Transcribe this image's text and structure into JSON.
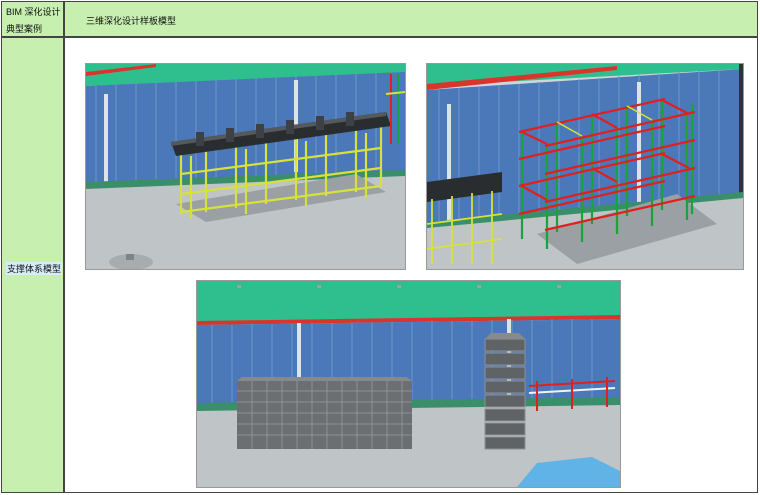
{
  "header": {
    "left_line1": "BIM 深化设计",
    "left_line2": "典型案例",
    "title": "三维深化设计样板模型"
  },
  "row": {
    "label": "支撑体系模型"
  },
  "images": [
    {
      "name": "support-frame-render-1"
    },
    {
      "name": "support-frame-render-2"
    },
    {
      "name": "formwork-stack-render"
    }
  ],
  "colors": {
    "cell_green": "#c6efb0",
    "label_highlight": "#d6ecf7",
    "scaffold_yellow": "#d6e23a",
    "scaffold_red": "#e02020",
    "scaffold_green": "#1aa33a",
    "wall_blue": "#4a78b8",
    "roof_teal": "#2fbf8f"
  }
}
